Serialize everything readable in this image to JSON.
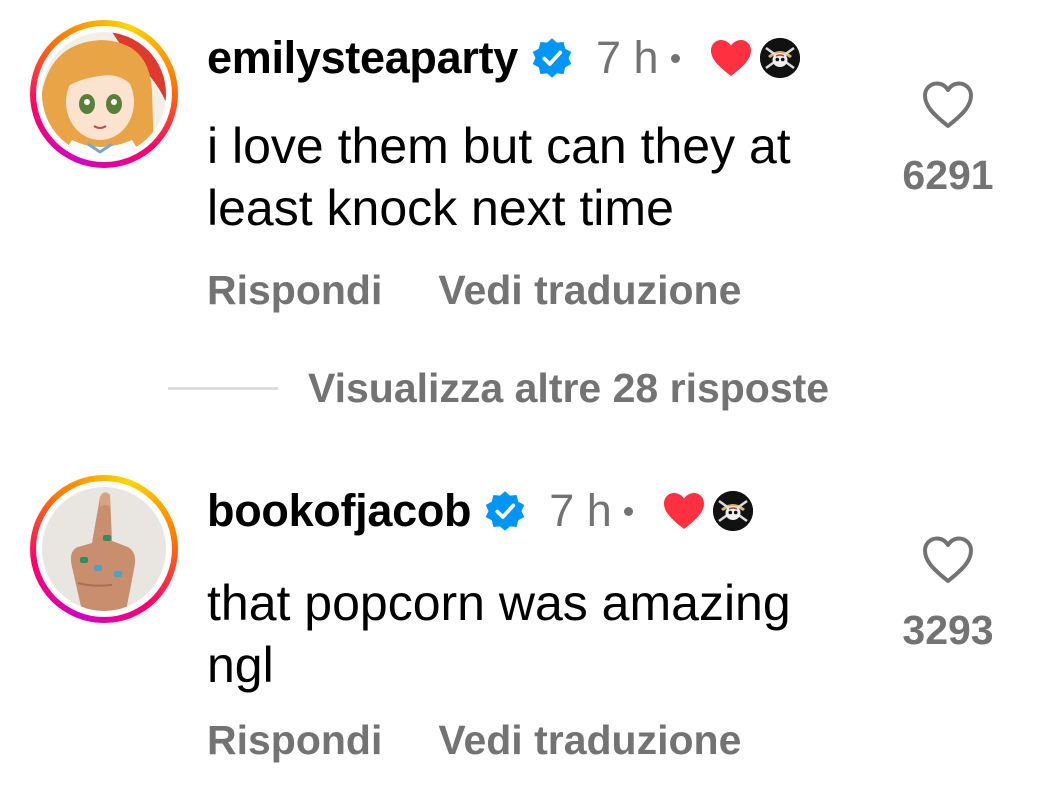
{
  "comments": [
    {
      "username": "emilysteaparty",
      "time": "7 h",
      "text": "i love them but can they at least knock next time",
      "likes": "6291",
      "reply_label": "Rispondi",
      "translate_label": "Vedi traduzione",
      "avatar_icon": "anime-girl-avatar",
      "verified_icon": "verified-badge-icon",
      "creator_liked_icon": "red-heart-icon",
      "creator_avatar_icon": "skull-avatar-icon"
    },
    {
      "username": "bookofjacob",
      "time": "7 h",
      "text": "that popcorn was amazing ngl",
      "likes": "3293",
      "reply_label": "Rispondi",
      "translate_label": "Vedi traduzione",
      "avatar_icon": "hand-avatar",
      "verified_icon": "verified-badge-icon",
      "creator_liked_icon": "red-heart-icon",
      "creator_avatar_icon": "skull-avatar-icon"
    }
  ],
  "more_replies": {
    "label": "Visualizza altre 28 risposte"
  },
  "colors": {
    "secondary_text": "#737373",
    "verified_blue": "#0095f6",
    "heart_red": "#ff3040",
    "divider": "#dbdbdb"
  }
}
